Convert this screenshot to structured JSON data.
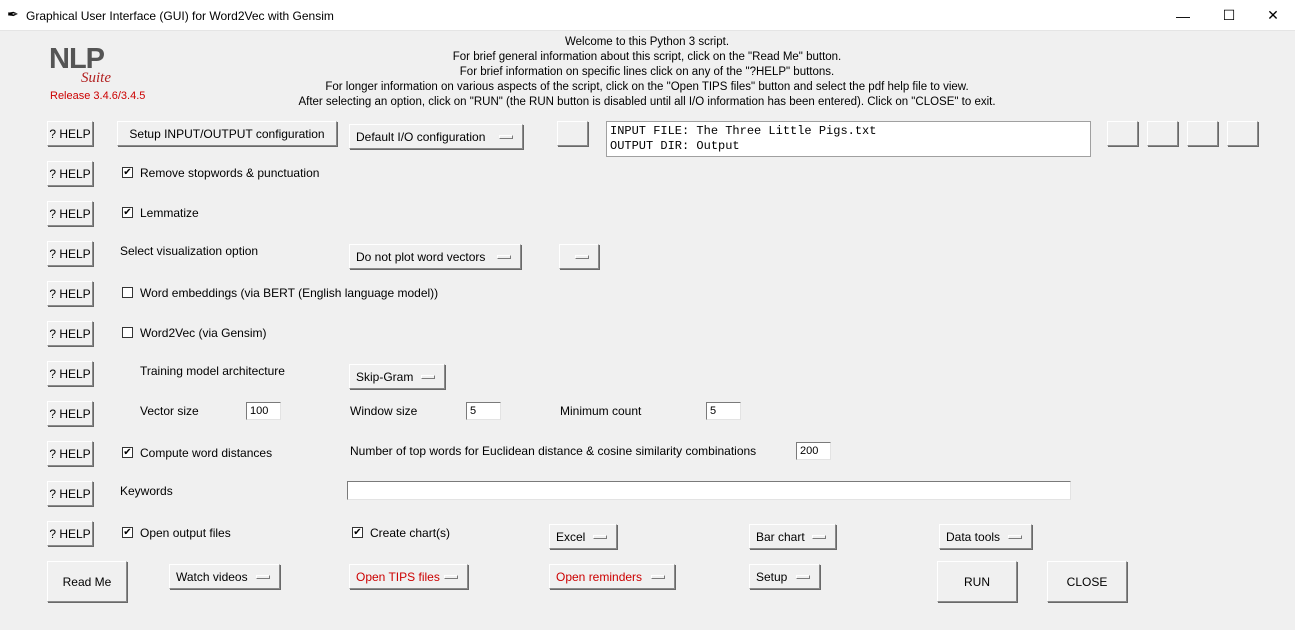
{
  "window": {
    "title": "Graphical User Interface (GUI) for Word2Vec with Gensim",
    "minimize": "—",
    "maximize": "☐",
    "close": "✕"
  },
  "logo": {
    "nlp": "NLP",
    "suite": "Suite",
    "release": "Release 3.4.6/3.4.5"
  },
  "welcome": [
    "Welcome to this Python 3 script.",
    "For brief general information about this script, click on the \"Read Me\" button.",
    "For brief information on specific lines click on any of the \"?HELP\" buttons.",
    "For longer information on various aspects of the script, click on the \"Open TIPS files\" button and select the pdf help file to view.",
    "After selecting an option, click on \"RUN\" (the RUN button is disabled until all I/O information has been entered).   Click on \"CLOSE\" to exit."
  ],
  "help_label": "? HELP",
  "io": {
    "setup_button": "Setup INPUT/OUTPUT configuration",
    "config_menu": "Default I/O configuration",
    "input_line": "INPUT FILE: The Three Little Pigs.txt",
    "output_line": "OUTPUT DIR: Output"
  },
  "options": {
    "remove_stopwords": {
      "label": "Remove stopwords & punctuation",
      "checked": true
    },
    "lemmatize": {
      "label": "Lemmatize",
      "checked": true
    },
    "visualization_label": "Select visualization option",
    "visualization_value": "Do not plot word vectors",
    "bert": {
      "label": "Word embeddings (via BERT (English language model))",
      "checked": false
    },
    "word2vec": {
      "label": "Word2Vec (via Gensim)",
      "checked": false
    },
    "training_label": "Training model architecture",
    "training_value": "Skip-Gram",
    "vector_size_label": "Vector size",
    "vector_size": "100",
    "window_size_label": "Window size",
    "window_size": "5",
    "min_count_label": "Minimum count",
    "min_count": "5",
    "compute_distances": {
      "label": "Compute word distances",
      "checked": true
    },
    "top_words_label": "Number of top words for Euclidean distance & cosine similarity combinations",
    "top_words": "200",
    "keywords_label": "Keywords",
    "keywords": "",
    "open_output": {
      "label": "Open output files",
      "checked": true
    },
    "create_charts": {
      "label": "Create chart(s)",
      "checked": true
    },
    "chart_package": "Excel",
    "chart_type": "Bar chart",
    "data_tools": "Data tools"
  },
  "bottom": {
    "read_me": "Read Me",
    "watch_videos": "Watch videos",
    "open_tips": "Open TIPS files",
    "open_reminders": "Open reminders",
    "setup": "Setup",
    "run": "RUN",
    "close": "CLOSE"
  },
  "check_glyph": "✔"
}
